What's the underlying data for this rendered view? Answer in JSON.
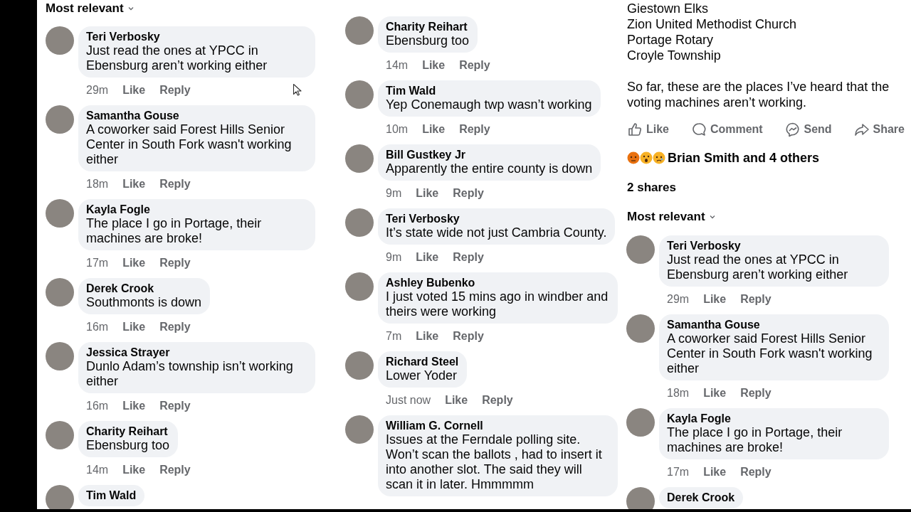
{
  "columns": [
    {
      "sort_label": "Most relevant",
      "comments": [
        {
          "name": "Teri Verbosky",
          "text": "Just read the ones at YPCC in Ebensburg aren’t working either",
          "time": "29m",
          "like": "Like",
          "reply": "Reply"
        },
        {
          "name": "Samantha Gouse",
          "text": "A coworker said Forest Hills Senior Center in South Fork wasn't working either",
          "time": "18m",
          "like": "Like",
          "reply": "Reply"
        },
        {
          "name": "Kayla Fogle",
          "text": "The place I go in Portage, their machines are broke!",
          "time": "17m",
          "like": "Like",
          "reply": "Reply"
        },
        {
          "name": "Derek Crook",
          "text": "Southmonts is down",
          "time": "16m",
          "like": "Like",
          "reply": "Reply"
        },
        {
          "name": "Jessica Strayer",
          "text": "Dunlo Adam’s township isn’t working either",
          "time": "16m",
          "like": "Like",
          "reply": "Reply"
        },
        {
          "name": "Charity Reihart",
          "text": "Ebensburg too",
          "time": "14m",
          "like": "Like",
          "reply": "Reply"
        },
        {
          "name": "Tim Wald"
        }
      ]
    },
    {
      "comments": [
        {
          "name": "Charity Reihart",
          "text": "Ebensburg too",
          "time": "14m",
          "like": "Like",
          "reply": "Reply"
        },
        {
          "name": "Tim Wald",
          "text": "Yep Conemaugh twp wasn’t working",
          "time": "10m",
          "like": "Like",
          "reply": "Reply"
        },
        {
          "name": "Bill Gustkey Jr",
          "text": "Apparently the entire county is down",
          "time": "9m",
          "like": "Like",
          "reply": "Reply"
        },
        {
          "name": "Teri Verbosky",
          "text": "It’s state wide not just Cambria County.",
          "time": "9m",
          "like": "Like",
          "reply": "Reply"
        },
        {
          "name": "Ashley Bubenko",
          "text": "I just voted 15 mins ago in windber and theirs were working",
          "time": "7m",
          "like": "Like",
          "reply": "Reply"
        },
        {
          "name": "Richard Steel",
          "text": "Lower Yoder",
          "time": "Just now",
          "like": "Like",
          "reply": "Reply"
        },
        {
          "name": "William G. Cornell",
          "text": "Issues at the Ferndale polling site. Won’t scan the ballots , had to insert it into another slot. The said they will scan it in later.  Hmmmmm"
        }
      ]
    },
    {
      "post": {
        "lines": [
          "Giestown Elks",
          "Zion United Methodist Church",
          "Portage Rotary",
          "Croyle Township"
        ],
        "text": "So far, these are the places I’ve heard that the voting machines aren’t working.",
        "actions": [
          {
            "kind": "like",
            "label": "Like"
          },
          {
            "kind": "comment",
            "label": "Comment"
          },
          {
            "kind": "send",
            "label": "Send"
          },
          {
            "kind": "share",
            "label": "Share"
          }
        ],
        "reactions": "Brian Smith and 4 others",
        "shares": "2 shares"
      },
      "sort_label": "Most relevant",
      "comments": [
        {
          "name": "Teri Verbosky",
          "text": "Just read the ones at YPCC in Ebensburg aren’t working either",
          "time": "29m",
          "like": "Like",
          "reply": "Reply"
        },
        {
          "name": "Samantha Gouse",
          "text": "A coworker said Forest Hills Senior Center in South Fork wasn't working either",
          "time": "18m",
          "like": "Like",
          "reply": "Reply"
        },
        {
          "name": "Kayla Fogle",
          "text": "The place I go in Portage, their machines are broke!",
          "time": "17m",
          "like": "Like",
          "reply": "Reply"
        },
        {
          "name": "Derek Crook"
        }
      ]
    }
  ]
}
